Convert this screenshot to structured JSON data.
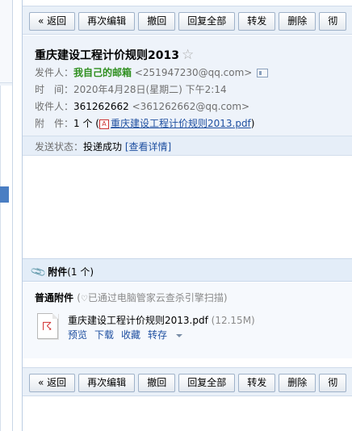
{
  "toolbar": {
    "back": "« 返回",
    "reedit": "再次编辑",
    "recall": "撤回",
    "reply_all": "回复全部",
    "forward": "转发",
    "delete": "删除",
    "more": "彻"
  },
  "mail": {
    "subject": "重庆建设工程计价规则2013",
    "star": "☆",
    "sender_label": "发件人：",
    "sender_name": "我自己的邮箱",
    "sender_email": "<251947230@qq.com>",
    "time_label": "时　间：",
    "time_value": "2020年4月28日(星期二) 下午2:14",
    "to_label": "收件人：",
    "to_name": "361262662",
    "to_email": "<361262662@qq.com>",
    "attach_label": "附　件：",
    "attach_count": "1 个 (",
    "attach_file": "重庆建设工程计价规则2013.pdf",
    "attach_close": ")"
  },
  "status": {
    "label": "发送状态：",
    "value": "投递成功",
    "detail": "[查看详情]"
  },
  "attachments": {
    "title": "附件",
    "count": "(1 个)",
    "group_label": "普通附件",
    "scan_text": "已通过电脑管家云查杀引擎扫描)",
    "scan_open": "(",
    "file_name": "重庆建设工程计价规则2013.pdf",
    "file_size": "(12.15M)",
    "actions": {
      "preview": "预览",
      "download": "下载",
      "favorite": "收藏",
      "save_to": "转存"
    }
  },
  "colors": {
    "sender_green": "#2f8f1f",
    "link_blue": "#1e4fa0",
    "header_bg": "#eef3fa"
  }
}
